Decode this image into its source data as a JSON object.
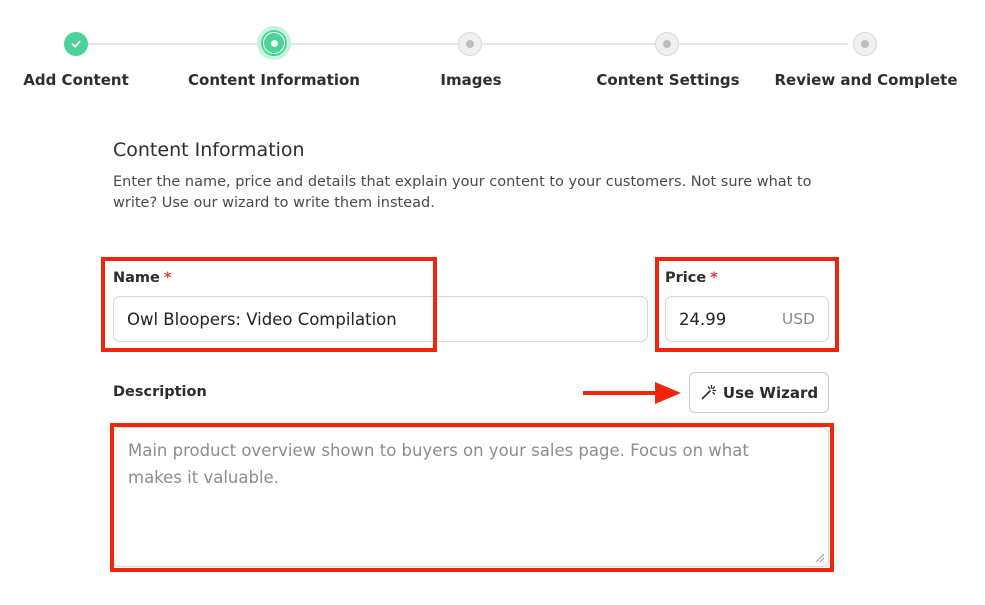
{
  "stepper": {
    "steps": [
      {
        "label": "Add Content",
        "status": "done",
        "icon": "check-icon"
      },
      {
        "label": "Content Information",
        "status": "active"
      },
      {
        "label": "Images",
        "status": "pending"
      },
      {
        "label": "Content Settings",
        "status": "pending"
      },
      {
        "label": "Review and Complete",
        "status": "pending"
      }
    ]
  },
  "section": {
    "title": "Content Information",
    "description": "Enter the name, price and details that explain your content to your customers. Not sure what to write? Use our wizard to write them instead."
  },
  "form": {
    "name_label": "Name",
    "name_value": "Owl Bloopers: Video Compilation",
    "price_label": "Price",
    "price_value": "24.99",
    "price_unit": "USD",
    "required_mark": "*",
    "description_label": "Description",
    "description_placeholder": "Main product overview shown to buyers on your sales page. Focus on what makes it valuable.",
    "wizard_button": "Use Wizard",
    "wizard_icon": "magic-wand-icon"
  },
  "colors": {
    "accent": "#4cd39a",
    "accent_light": "#c6f2de",
    "annotation": "#f0260c",
    "required": "#e53935"
  }
}
